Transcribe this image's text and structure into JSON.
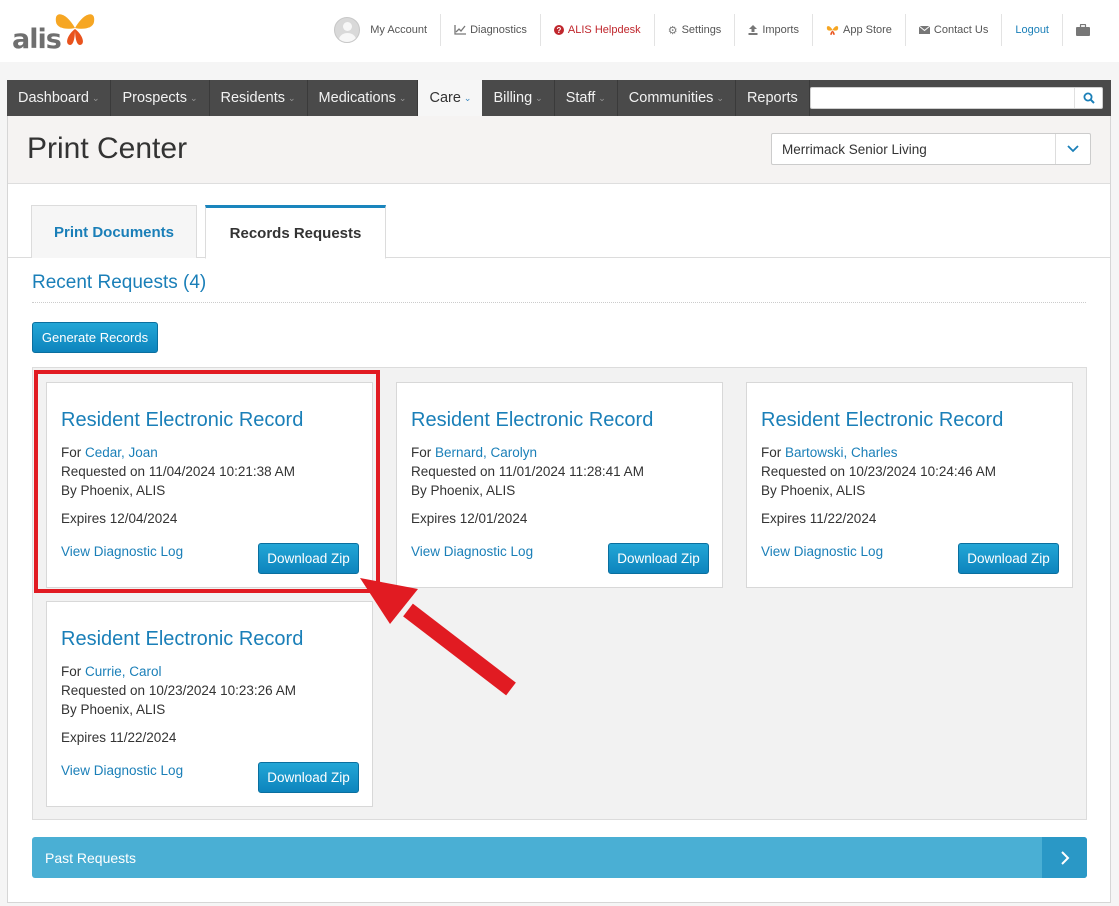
{
  "header": {
    "logo_text": "alis",
    "links": [
      {
        "label": "My Account",
        "icon": "avatar"
      },
      {
        "label": "Diagnostics",
        "icon": "chart-icon"
      },
      {
        "label": "ALIS Helpdesk",
        "icon": "question-circle-icon"
      },
      {
        "label": "Settings",
        "icon": "gear-icon"
      },
      {
        "label": "Imports",
        "icon": "upload-icon"
      },
      {
        "label": "App Store",
        "icon": "butterfly-icon"
      },
      {
        "label": "Contact Us",
        "icon": "envelope-icon"
      },
      {
        "label": "Logout",
        "icon": ""
      },
      {
        "label": "",
        "icon": "briefcase-icon"
      }
    ]
  },
  "nav": {
    "items": [
      {
        "label": "Dashboard",
        "dropdown": true
      },
      {
        "label": "Prospects",
        "dropdown": true
      },
      {
        "label": "Residents",
        "dropdown": true
      },
      {
        "label": "Medications",
        "dropdown": true
      },
      {
        "label": "Care",
        "dropdown": true,
        "active": true
      },
      {
        "label": "Billing",
        "dropdown": true
      },
      {
        "label": "Staff",
        "dropdown": true
      },
      {
        "label": "Communities",
        "dropdown": true
      },
      {
        "label": "Reports",
        "dropdown": false
      }
    ],
    "search": {
      "placeholder": "",
      "value": ""
    }
  },
  "page": {
    "title": "Print Center",
    "community": "Merrimack Senior Living"
  },
  "tabs": {
    "print_documents": "Print Documents",
    "records_requests": "Records Requests",
    "active": "Records Requests"
  },
  "recent": {
    "heading": "Recent Requests (4)",
    "generate_button": "Generate Records",
    "cards": [
      {
        "title": "Resident Electronic Record",
        "for_prefix": "For",
        "resident": "Cedar, Joan",
        "requested": "Requested on 11/04/2024 10:21:38 AM",
        "by": "By Phoenix, ALIS",
        "expires": "Expires 12/04/2024",
        "diag_link": "View Diagnostic Log",
        "download": "Download Zip"
      },
      {
        "title": "Resident Electronic Record",
        "for_prefix": "For",
        "resident": "Bernard, Carolyn",
        "requested": "Requested on 11/01/2024 11:28:41 AM",
        "by": "By Phoenix, ALIS",
        "expires": "Expires 12/01/2024",
        "diag_link": "View Diagnostic Log",
        "download": "Download Zip"
      },
      {
        "title": "Resident Electronic Record",
        "for_prefix": "For",
        "resident": "Bartowski, Charles",
        "requested": "Requested on 10/23/2024 10:24:46 AM",
        "by": "By Phoenix, ALIS",
        "expires": "Expires 11/22/2024",
        "diag_link": "View Diagnostic Log",
        "download": "Download Zip"
      },
      {
        "title": "Resident Electronic Record",
        "for_prefix": "For",
        "resident": "Currie, Carol",
        "requested": "Requested on 10/23/2024 10:23:26 AM",
        "by": "By Phoenix, ALIS",
        "expires": "Expires 11/22/2024",
        "diag_link": "View Diagnostic Log",
        "download": "Download Zip"
      }
    ]
  },
  "past": {
    "label": "Past Requests"
  },
  "colors": {
    "accent_blue": "#1a7fb8",
    "nav_bg": "#4a4a4a",
    "highlight_red": "#e11b22",
    "past_bar": "#4aafd4"
  }
}
